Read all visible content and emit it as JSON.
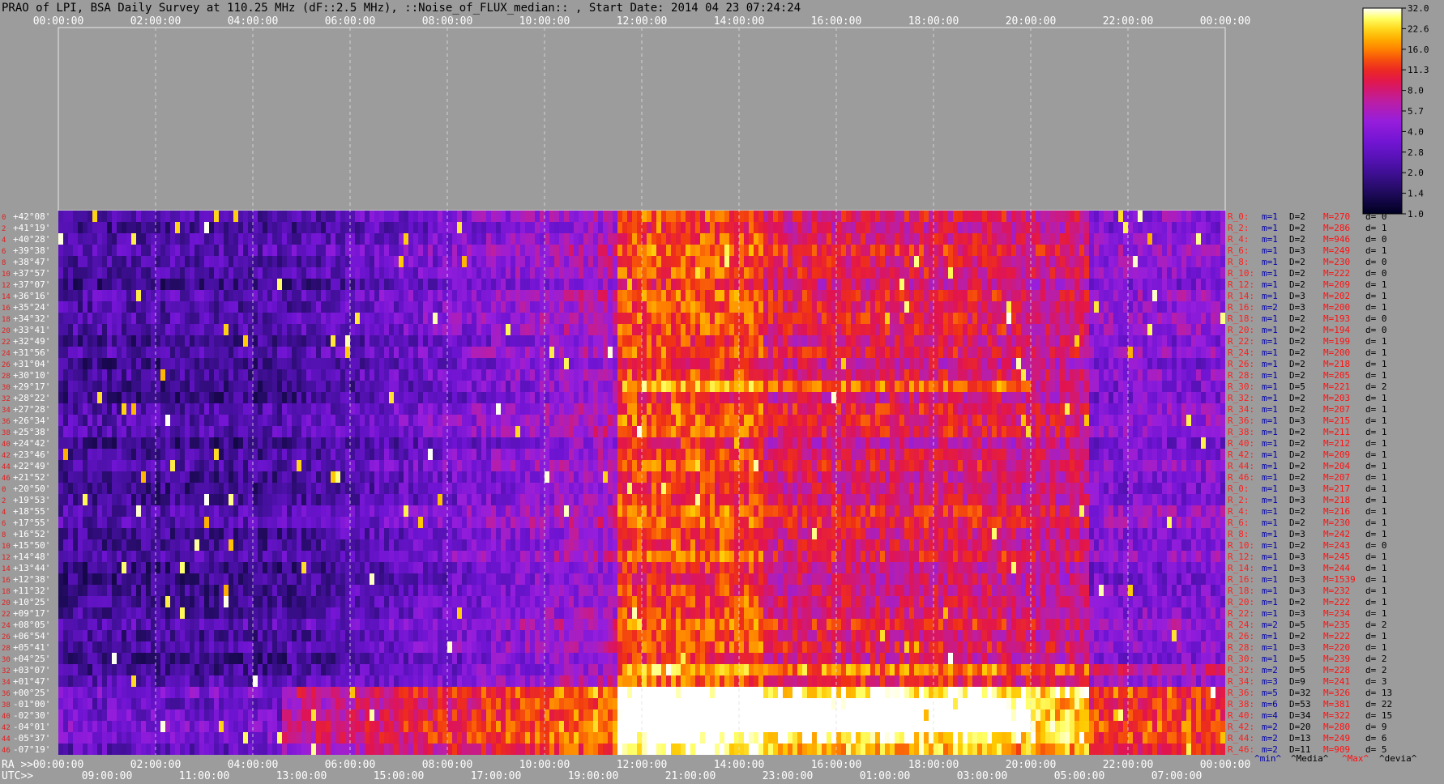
{
  "chart_data": {
    "type": "heatmap",
    "title": "PRAO of LPI, BSA Daily Survey at 110.25 MHz (dF::2.5 MHz), ::Noise_of_FLUX_median:: , Start Date: 2014 04 23 07:24:24",
    "top_ticks": [
      "00:00:00",
      "02:00:00",
      "04:00:00",
      "06:00:00",
      "08:00:00",
      "10:00:00",
      "12:00:00",
      "14:00:00",
      "16:00:00",
      "18:00:00",
      "20:00:00",
      "22:00:00",
      "00:00:00"
    ],
    "ra_label": "RA >>",
    "ra_ticks": [
      "00:00:00",
      "02:00:00",
      "04:00:00",
      "06:00:00",
      "08:00:00",
      "10:00:00",
      "12:00:00",
      "14:00:00",
      "16:00:00",
      "18:00:00",
      "20:00:00",
      "22:00:00",
      "00:00:00"
    ],
    "utc_label": "UTC>>",
    "utc_ticks": [
      "09:00:00",
      "11:00:00",
      "13:00:00",
      "15:00:00",
      "17:00:00",
      "19:00:00",
      "21:00:00",
      "23:00:00",
      "01:00:00",
      "03:00:00",
      "05:00:00",
      "07:00:00"
    ],
    "declinations": [
      "+42°08'",
      "+41°19'",
      "+40°28'",
      "+39°38'",
      "+38°47'",
      "+37°57'",
      "+37°07'",
      "+36°16'",
      "+35°24'",
      "+34°32'",
      "+33°41'",
      "+32°49'",
      "+31°56'",
      "+31°04'",
      "+30°10'",
      "+29°17'",
      "+28°22'",
      "+27°28'",
      "+26°34'",
      "+25°38'",
      "+24°42'",
      "+23°46'",
      "+22°49'",
      "+21°52'",
      "+20°50'",
      "+19°53'",
      "+18°55'",
      "+17°55'",
      "+16°52'",
      "+15°50'",
      "+14°48'",
      "+13°44'",
      "+12°38'",
      "+11°32'",
      "+10°25'",
      "+09°17'",
      "+08°05'",
      "+06°54'",
      "+05°41'",
      "+04°25'",
      "+03°07'",
      "+01°47'",
      "+00°25'",
      "-01°00'",
      "-02°30'",
      "-04°01'",
      "-05°37'",
      "-07°19'"
    ],
    "ray_indices": [
      "0",
      "2",
      "4",
      "6",
      "8",
      "10",
      "12",
      "14",
      "16",
      "18",
      "20",
      "22",
      "24",
      "26",
      "28",
      "30",
      "32",
      "34",
      "36",
      "38",
      "40",
      "42",
      "44",
      "46",
      "0",
      "2",
      "4",
      "6",
      "8",
      "10",
      "12",
      "14",
      "16",
      "18",
      "20",
      "22",
      "24",
      "26",
      "28",
      "30",
      "32",
      "34",
      "36",
      "38",
      "40",
      "42",
      "44",
      "46"
    ],
    "ray_stats": [
      {
        "ray": "R_0:",
        "min": "m=1",
        "d": "D=2",
        "max": "M=270",
        "dev": "d= 0"
      },
      {
        "ray": "R_2:",
        "min": "m=1",
        "d": "D=2",
        "max": "M=286",
        "dev": "d= 1"
      },
      {
        "ray": "R_4:",
        "min": "m=1",
        "d": "D=2",
        "max": "M=946",
        "dev": "d= 0"
      },
      {
        "ray": "R_6:",
        "min": "m=1",
        "d": "D=3",
        "max": "M=249",
        "dev": "d= 1"
      },
      {
        "ray": "R_8:",
        "min": "m=1",
        "d": "D=2",
        "max": "M=230",
        "dev": "d= 0"
      },
      {
        "ray": "R_10:",
        "min": "m=1",
        "d": "D=2",
        "max": "M=222",
        "dev": "d= 0"
      },
      {
        "ray": "R_12:",
        "min": "m=1",
        "d": "D=2",
        "max": "M=209",
        "dev": "d= 1"
      },
      {
        "ray": "R_14:",
        "min": "m=1",
        "d": "D=3",
        "max": "M=202",
        "dev": "d= 1"
      },
      {
        "ray": "R_16:",
        "min": "m=2",
        "d": "D=3",
        "max": "M=200",
        "dev": "d= 1"
      },
      {
        "ray": "R_18:",
        "min": "m=1",
        "d": "D=2",
        "max": "M=193",
        "dev": "d= 0"
      },
      {
        "ray": "R_20:",
        "min": "m=1",
        "d": "D=2",
        "max": "M=194",
        "dev": "d= 0"
      },
      {
        "ray": "R_22:",
        "min": "m=1",
        "d": "D=2",
        "max": "M=199",
        "dev": "d= 1"
      },
      {
        "ray": "R_24:",
        "min": "m=1",
        "d": "D=2",
        "max": "M=200",
        "dev": "d= 1"
      },
      {
        "ray": "R_26:",
        "min": "m=1",
        "d": "D=2",
        "max": "M=218",
        "dev": "d= 1"
      },
      {
        "ray": "R_28:",
        "min": "m=1",
        "d": "D=2",
        "max": "M=205",
        "dev": "d= 1"
      },
      {
        "ray": "R_30:",
        "min": "m=1",
        "d": "D=5",
        "max": "M=221",
        "dev": "d= 2"
      },
      {
        "ray": "R_32:",
        "min": "m=1",
        "d": "D=2",
        "max": "M=203",
        "dev": "d= 1"
      },
      {
        "ray": "R_34:",
        "min": "m=1",
        "d": "D=2",
        "max": "M=207",
        "dev": "d= 1"
      },
      {
        "ray": "R_36:",
        "min": "m=1",
        "d": "D=3",
        "max": "M=215",
        "dev": "d= 1"
      },
      {
        "ray": "R_38:",
        "min": "m=1",
        "d": "D=2",
        "max": "M=211",
        "dev": "d= 1"
      },
      {
        "ray": "R_40:",
        "min": "m=1",
        "d": "D=2",
        "max": "M=212",
        "dev": "d= 1"
      },
      {
        "ray": "R_42:",
        "min": "m=1",
        "d": "D=2",
        "max": "M=209",
        "dev": "d= 1"
      },
      {
        "ray": "R_44:",
        "min": "m=1",
        "d": "D=2",
        "max": "M=204",
        "dev": "d= 1"
      },
      {
        "ray": "R_46:",
        "min": "m=1",
        "d": "D=2",
        "max": "M=207",
        "dev": "d= 1"
      },
      {
        "ray": "R_0:",
        "min": "m=1",
        "d": "D=3",
        "max": "M=217",
        "dev": "d= 1"
      },
      {
        "ray": "R_2:",
        "min": "m=1",
        "d": "D=3",
        "max": "M=218",
        "dev": "d= 1"
      },
      {
        "ray": "R_4:",
        "min": "m=1",
        "d": "D=2",
        "max": "M=216",
        "dev": "d= 1"
      },
      {
        "ray": "R_6:",
        "min": "m=1",
        "d": "D=2",
        "max": "M=230",
        "dev": "d= 1"
      },
      {
        "ray": "R_8:",
        "min": "m=1",
        "d": "D=3",
        "max": "M=242",
        "dev": "d= 1"
      },
      {
        "ray": "R_10:",
        "min": "m=1",
        "d": "D=2",
        "max": "M=243",
        "dev": "d= 0"
      },
      {
        "ray": "R_12:",
        "min": "m=1",
        "d": "D=3",
        "max": "M=245",
        "dev": "d= 1"
      },
      {
        "ray": "R_14:",
        "min": "m=1",
        "d": "D=3",
        "max": "M=244",
        "dev": "d= 1"
      },
      {
        "ray": "R_16:",
        "min": "m=1",
        "d": "D=3",
        "max": "M=1539",
        "dev": "d= 1"
      },
      {
        "ray": "R_18:",
        "min": "m=1",
        "d": "D=3",
        "max": "M=232",
        "dev": "d= 1"
      },
      {
        "ray": "R_20:",
        "min": "m=1",
        "d": "D=2",
        "max": "M=222",
        "dev": "d= 1"
      },
      {
        "ray": "R_22:",
        "min": "m=1",
        "d": "D=3",
        "max": "M=234",
        "dev": "d= 1"
      },
      {
        "ray": "R_24:",
        "min": "m=2",
        "d": "D=5",
        "max": "M=235",
        "dev": "d= 2"
      },
      {
        "ray": "R_26:",
        "min": "m=1",
        "d": "D=2",
        "max": "M=222",
        "dev": "d= 1"
      },
      {
        "ray": "R_28:",
        "min": "m=1",
        "d": "D=3",
        "max": "M=220",
        "dev": "d= 1"
      },
      {
        "ray": "R_30:",
        "min": "m=1",
        "d": "D=5",
        "max": "M=239",
        "dev": "d= 2"
      },
      {
        "ray": "R_32:",
        "min": "m=2",
        "d": "D=5",
        "max": "M=228",
        "dev": "d= 2"
      },
      {
        "ray": "R_34:",
        "min": "m=3",
        "d": "D=9",
        "max": "M=241",
        "dev": "d= 3"
      },
      {
        "ray": "R_36:",
        "min": "m=5",
        "d": "D=32",
        "max": "M=326",
        "dev": "d= 13"
      },
      {
        "ray": "R_38:",
        "min": "m=6",
        "d": "D=53",
        "max": "M=381",
        "dev": "d= 22"
      },
      {
        "ray": "R_40:",
        "min": "m=4",
        "d": "D=34",
        "max": "M=322",
        "dev": "d= 15"
      },
      {
        "ray": "R_42:",
        "min": "m=2",
        "d": "D=20",
        "max": "M=280",
        "dev": "d= 9"
      },
      {
        "ray": "R_44:",
        "min": "m=2",
        "d": "D=13",
        "max": "M=249",
        "dev": "d= 6"
      },
      {
        "ray": "R_46:",
        "min": "m=2",
        "d": "D=11",
        "max": "M=909",
        "dev": "d= 5"
      }
    ],
    "stats_footer": [
      "^min^",
      "^Media^",
      "^Max^",
      "^devia^"
    ],
    "colorbar": {
      "ticks": [
        "32.0",
        "22.6",
        "16.0",
        "11.3",
        "8.0",
        "5.7",
        "4.0",
        "2.8",
        "2.0",
        "1.4",
        "1.0"
      ],
      "colors": [
        "#000020",
        "#1a0a5a",
        "#3a10a0",
        "#6a10d0",
        "#9a20d8",
        "#c020a0",
        "#e01050",
        "#f03010",
        "#ff8000",
        "#ffc000",
        "#ffff60",
        "#ffffff"
      ]
    },
    "x_range_ra_hours": [
      0,
      24
    ],
    "grid": true
  }
}
